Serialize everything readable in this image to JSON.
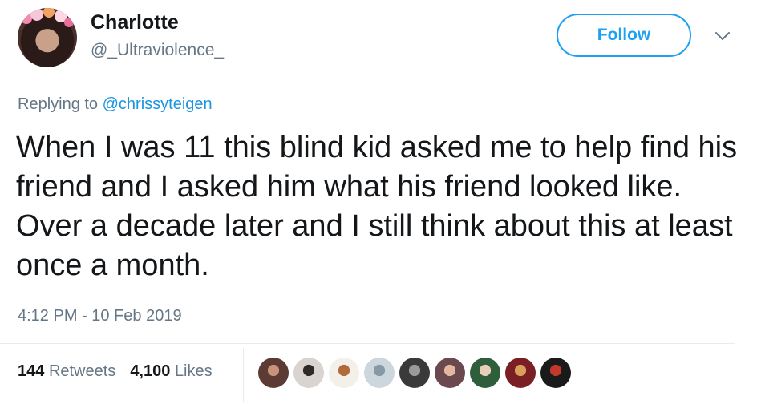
{
  "author": {
    "name": "Charlotte",
    "handle": "@_Ultraviolence_"
  },
  "follow_button": {
    "label": "Follow"
  },
  "reply": {
    "prefix": "Replying to ",
    "mention": "@chrissyteigen"
  },
  "tweet": {
    "text": "When I was 11 this blind kid asked me to help find his friend and I asked him what his friend looked like. Over a decade later and I still think about this at least once a month.",
    "timestamp": "4:12 PM - 10 Feb 2019"
  },
  "stats": {
    "retweets_count": "144",
    "retweets_label": "Retweets",
    "likes_count": "4,100",
    "likes_label": "Likes"
  },
  "liker_avatars": [
    {
      "name": "liker-avatar-1",
      "bg": "#5b3b33",
      "fg": "#c9927a"
    },
    {
      "name": "liker-avatar-2",
      "bg": "#d9d4cf",
      "fg": "#2d2a28"
    },
    {
      "name": "liker-avatar-3",
      "bg": "#f3efe9",
      "fg": "#b26a3a"
    },
    {
      "name": "liker-avatar-4",
      "bg": "#ccd6dd",
      "fg": "#8899a6"
    },
    {
      "name": "liker-avatar-5",
      "bg": "#3a3a3a",
      "fg": "#9a9a9a"
    },
    {
      "name": "liker-avatar-6",
      "bg": "#6b4a4f",
      "fg": "#e3b7a0"
    },
    {
      "name": "liker-avatar-7",
      "bg": "#2f5e3a",
      "fg": "#e8cfb8"
    },
    {
      "name": "liker-avatar-8",
      "bg": "#7a1f24",
      "fg": "#d9a05b"
    },
    {
      "name": "liker-avatar-9",
      "bg": "#1a1a1a",
      "fg": "#c0392b"
    }
  ],
  "colors": {
    "accent": "#1da1f2",
    "text_primary": "#14171a",
    "text_secondary": "#657786"
  },
  "icons": {
    "more_menu": "chevron-down-icon"
  }
}
